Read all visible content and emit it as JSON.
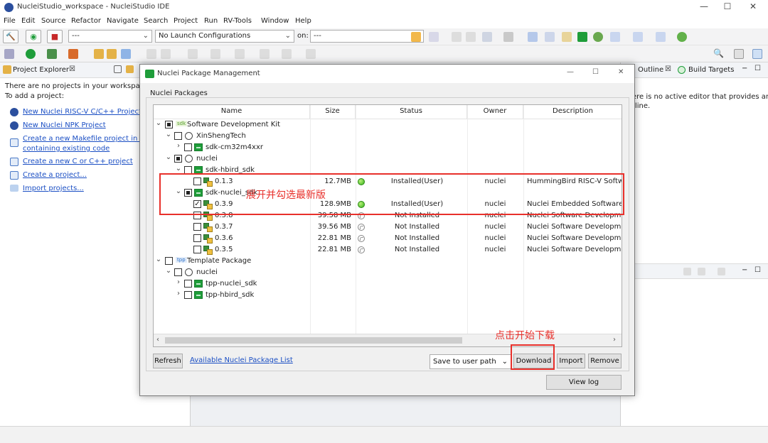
{
  "window": {
    "title": "NucleiStudio_workspace - NucleiStudio IDE",
    "min": "—",
    "max": "☐",
    "close": "✕"
  },
  "menu": [
    "File",
    "Edit",
    "Source",
    "Refactor",
    "Navigate",
    "Search",
    "Project",
    "Run",
    "RV-Tools",
    "Window",
    "Help"
  ],
  "toolbar": {
    "build_select": "---",
    "launch_config": "No Launch Configurations",
    "on_label": "on:",
    "target_select": "---"
  },
  "project_explorer": {
    "tab_label": "Project Explorer",
    "tab_close": "☒",
    "empty_line1": "There are no projects in your workspace.",
    "empty_line2": "To add a project:",
    "links": [
      "New Nuclei RISC-V C/C++ Project",
      "New Nuclei NPK Project",
      "Create a new Makefile project in a d",
      "containing existing code",
      "Create a new C or C++ project",
      "Create a project...",
      "Import projects..."
    ]
  },
  "right_panel": {
    "outline_tab": "Outline",
    "outline_close": "☒",
    "build_targets_tab": "Build Targets",
    "msg_line1": "ere is no active editor that provides an",
    "msg_line2": "tline."
  },
  "dialog": {
    "title": "Nuclei Package Management",
    "group_label": "Nuclei Packages",
    "columns": [
      "Name",
      "Size",
      "Status",
      "Owner",
      "Description"
    ],
    "rows": [
      {
        "name": "Software Development Kit",
        "size": "",
        "status": "",
        "owner": "",
        "desc": "",
        "state": ""
      },
      {
        "name": "XinShengTech",
        "size": "",
        "status": "",
        "owner": "",
        "desc": "",
        "state": ""
      },
      {
        "name": "sdk-cm32m4xxr",
        "size": "",
        "status": "",
        "owner": "",
        "desc": "",
        "state": ""
      },
      {
        "name": "nuclei",
        "size": "",
        "status": "",
        "owner": "",
        "desc": "",
        "state": ""
      },
      {
        "name": "sdk-hbird_sdk",
        "size": "",
        "status": "",
        "owner": "",
        "desc": "",
        "state": ""
      },
      {
        "name": "0.1.3",
        "size": "12.7MB",
        "status": "Installed(User)",
        "owner": "nuclei",
        "desc": "HummingBird RISC-V Software",
        "state": "on"
      },
      {
        "name": "sdk-nuclei_sdk",
        "size": "",
        "status": "",
        "owner": "",
        "desc": "",
        "state": ""
      },
      {
        "name": "0.3.9",
        "size": "128.9MB",
        "status": "Installed(User)",
        "owner": "nuclei",
        "desc": "Nuclei Embedded Software Dev",
        "state": "on"
      },
      {
        "name": "0.3.8",
        "size": "39.58 MB",
        "status": "Not Installed",
        "owner": "nuclei",
        "desc": "Nuclei Software Development",
        "state": "off"
      },
      {
        "name": "0.3.7",
        "size": "39.56 MB",
        "status": "Not Installed",
        "owner": "nuclei",
        "desc": "Nuclei Software Development",
        "state": "off"
      },
      {
        "name": "0.3.6",
        "size": "22.81 MB",
        "status": "Not Installed",
        "owner": "nuclei",
        "desc": "Nuclei Software Development",
        "state": "off"
      },
      {
        "name": "0.3.5",
        "size": "22.81 MB",
        "status": "Not Installed",
        "owner": "nuclei",
        "desc": "Nuclei Software Development",
        "state": "off"
      },
      {
        "name": "Template Package",
        "size": "",
        "status": "",
        "owner": "",
        "desc": "",
        "state": ""
      },
      {
        "name": "nuclei",
        "size": "",
        "status": "",
        "owner": "",
        "desc": "",
        "state": ""
      },
      {
        "name": "tpp-nuclei_sdk",
        "size": "",
        "status": "",
        "owner": "",
        "desc": "",
        "state": ""
      },
      {
        "name": "tpp-hbird_sdk",
        "size": "",
        "status": "",
        "owner": "",
        "desc": "",
        "state": ""
      }
    ],
    "sdk_badge": "sdk",
    "tpp_badge": "tpp",
    "refresh": "Refresh",
    "available_link": "Available Nuclei Package List",
    "save_path": "Save to user path",
    "download": "Download",
    "import": "Import",
    "remove": "Remove",
    "view_log": "View log"
  },
  "annotations": {
    "expand_note": "展开并勾选最新版",
    "download_note": "点击开始下载"
  },
  "colors": {
    "annotation": "#e8302b",
    "link": "#1b4fc4",
    "installed": "#36b31a"
  }
}
